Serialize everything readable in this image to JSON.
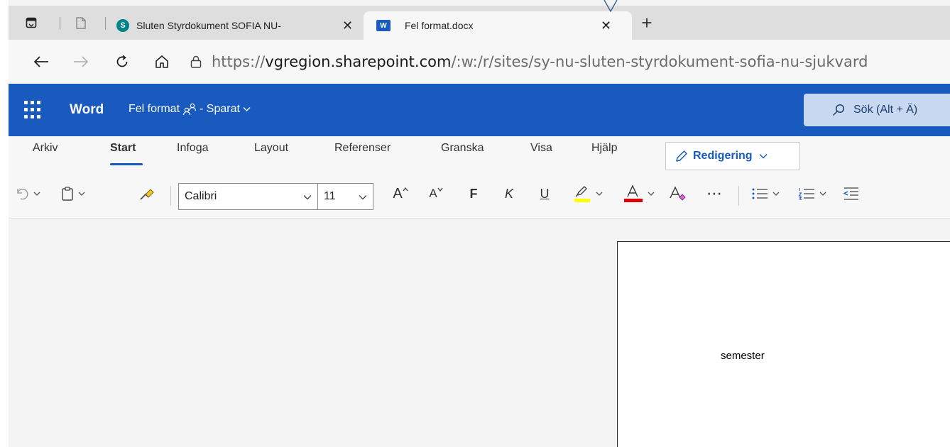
{
  "browser": {
    "tabs": [
      {
        "title": "Sluten Styrdokument SOFIA NU-",
        "favicon_letter": "S",
        "favicon_color": "#038387",
        "active": false
      },
      {
        "title": "Fel format.docx",
        "favicon_letter": "W",
        "favicon_color": "#185abd",
        "active": true
      }
    ],
    "close_glyph": "✕",
    "new_tab_glyph": "+",
    "url": {
      "prefix": "https://",
      "host": "vgregion.sharepoint.com",
      "path": "/:w:/r/sites/sy-nu-sluten-styrdokument-sofia-nu-sjukvard"
    }
  },
  "word": {
    "app_name": "Word",
    "doc_title": "Fel format",
    "save_status": "- Sparat",
    "search_placeholder": "Sök (Alt + Ä)",
    "brand_color": "#185abd"
  },
  "ribbon": {
    "tabs": [
      "Arkiv",
      "Start",
      "Infoga",
      "Layout",
      "Referenser",
      "Granska",
      "Visa",
      "Hjälp"
    ],
    "active_tab": "Start",
    "mode_label": "Redigering",
    "font_name": "Calibri",
    "font_size": "11",
    "bold_label": "F",
    "italic_label": "K",
    "underline_label": "U",
    "grow_font_label": "A",
    "shrink_font_label": "A",
    "more_label": "⋯",
    "highlight_color": "#ffff00",
    "font_color": "#e00000"
  },
  "document": {
    "text": "semester"
  }
}
